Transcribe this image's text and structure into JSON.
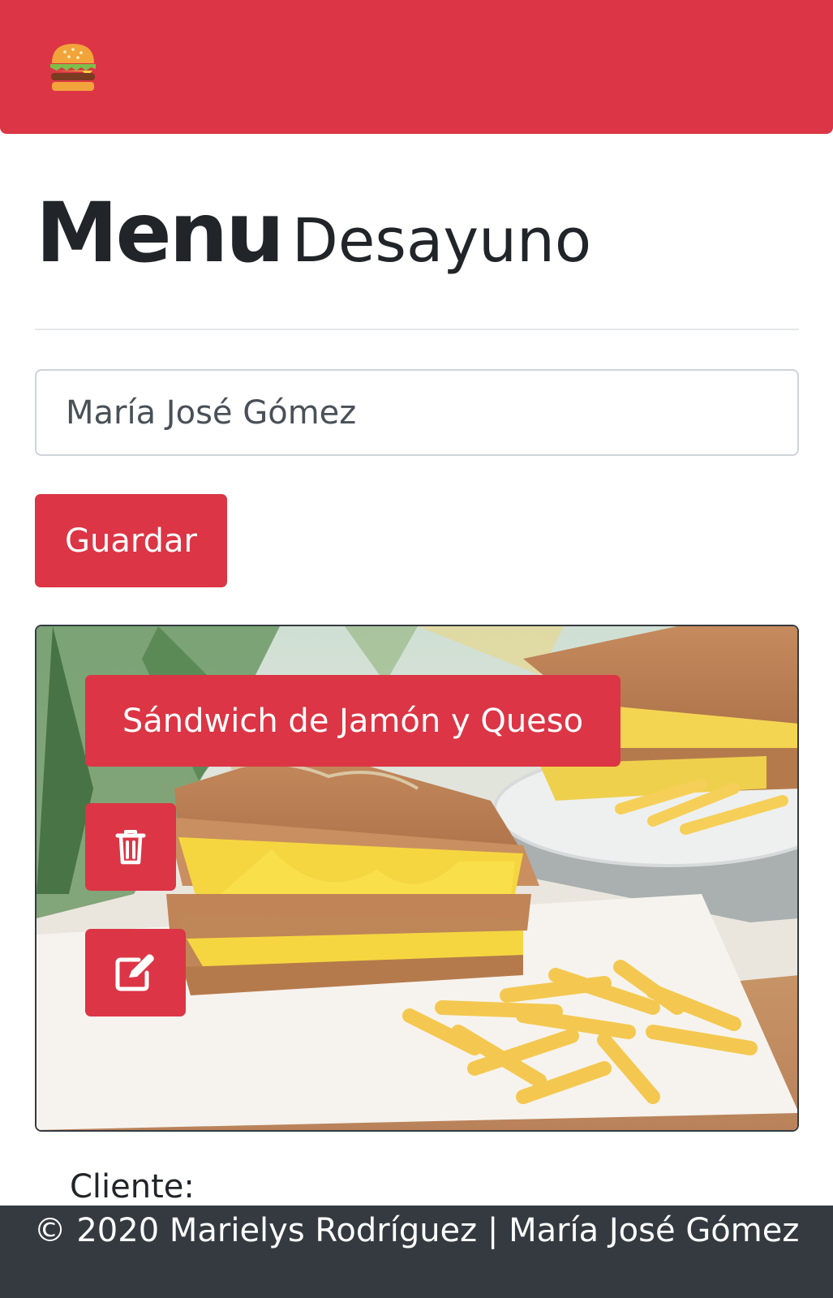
{
  "navbar": {
    "logo_icon": "hamburger-icon",
    "color": "#dc3545"
  },
  "header": {
    "title": "Menu",
    "subtitle": "Desayuno"
  },
  "form": {
    "name_value": "María José Gómez",
    "save_label": "Guardar"
  },
  "menu_items": [
    {
      "name": "Sándwich de Jamón y Queso",
      "image_icon": "grilled-sandwich-fries-photo",
      "delete_icon": "trash-icon",
      "edit_icon": "edit-icon"
    }
  ],
  "client": {
    "label": "Cliente:"
  },
  "footer": {
    "text": "© 2020 Marielys Rodríguez | María José Gómez"
  },
  "colors": {
    "primary": "#dc3545",
    "dark": "#343a40",
    "text": "#212529"
  }
}
